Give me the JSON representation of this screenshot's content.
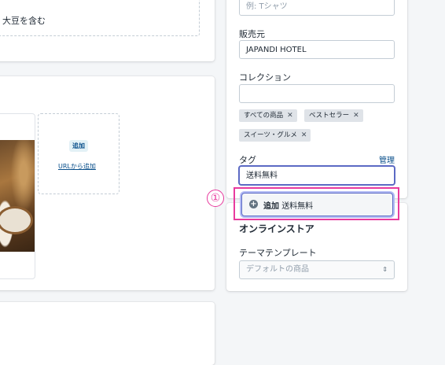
{
  "allergen": {
    "item": "大豆を含む"
  },
  "media": {
    "add_badge": "追加",
    "url_link": "URLから追加"
  },
  "product": {
    "type_placeholder": "例: Tシャツ",
    "vendor_label": "販売元",
    "vendor_value": "JAPANDI HOTEL",
    "collection_label": "コレクション",
    "collections": [
      "すべての商品",
      "ベストセラー",
      "スイーツ・グルメ"
    ],
    "tag_label": "タグ",
    "manage_label": "管理",
    "tag_input_value": "送料無料",
    "dropdown_add": "追加",
    "dropdown_value": "送料無料"
  },
  "annotation": {
    "step": "1"
  },
  "online_store": {
    "title": "オンラインストア",
    "template_label": "テーマテンプレート",
    "template_value": "デフォルトの商品"
  },
  "colors": {
    "highlight": "#e83a9e",
    "link": "#084e8a",
    "focus": "#5c6ac4"
  }
}
